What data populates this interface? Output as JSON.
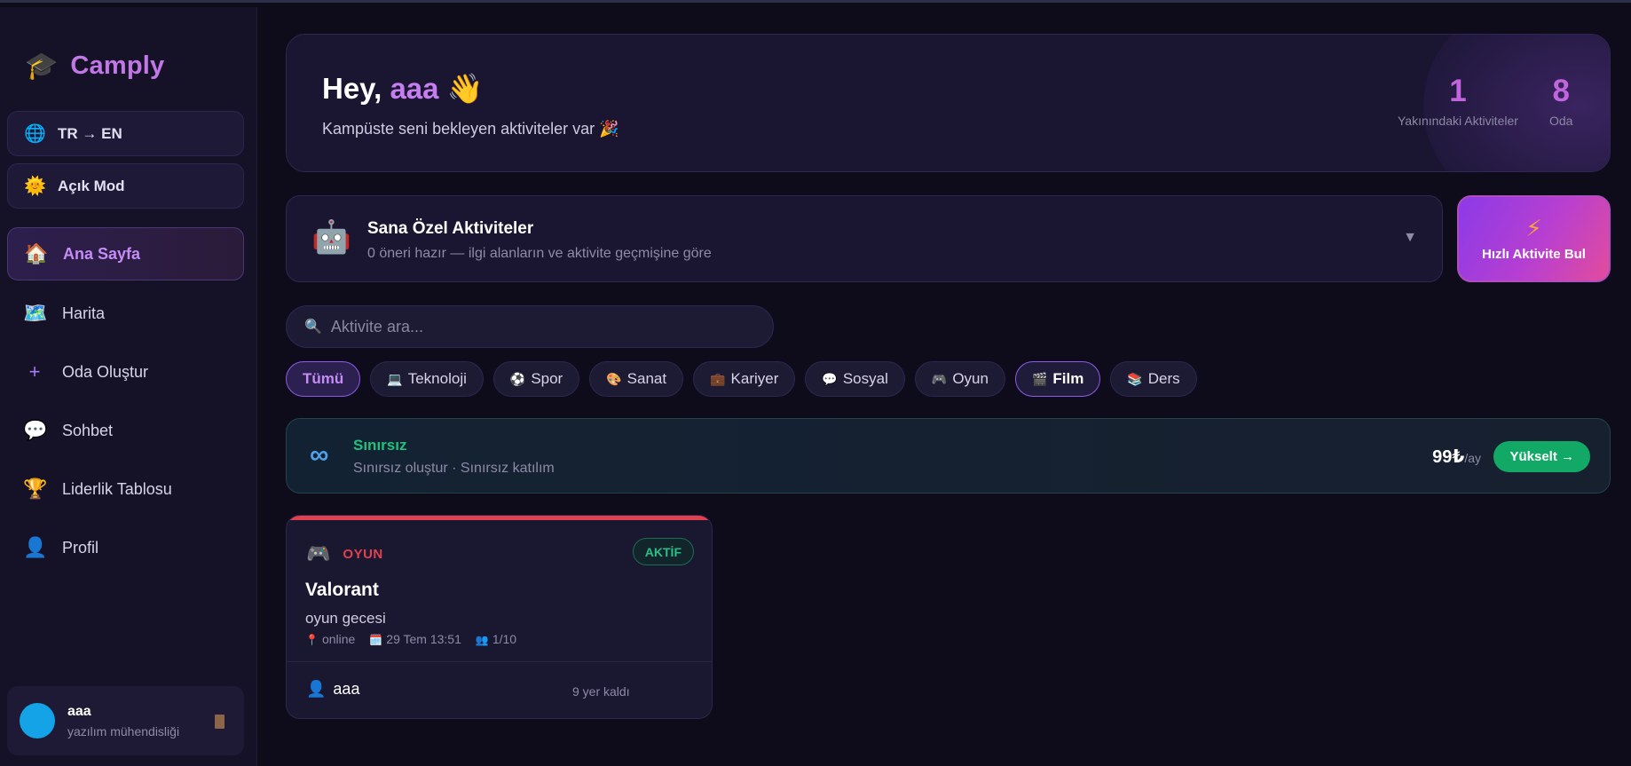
{
  "app": {
    "name": "Camply",
    "logo_icon": "🎓"
  },
  "sidebar": {
    "lang_toggle": {
      "icon": "🌐",
      "label": "TR → EN"
    },
    "theme_toggle": {
      "icon": "🌞",
      "label": "Açık Mod"
    },
    "items": [
      {
        "icon": "🏠",
        "label": "Ana Sayfa",
        "active": true
      },
      {
        "icon": "🗺️",
        "label": "Harita"
      },
      {
        "icon": "+",
        "label": "Oda Oluştur"
      },
      {
        "icon": "💬",
        "label": "Sohbet"
      },
      {
        "icon": "🏆",
        "label": "Liderlik Tablosu"
      },
      {
        "icon": "👤",
        "label": "Profil"
      }
    ],
    "user": {
      "name": "aaa",
      "department": "yazılım mühendisliği"
    }
  },
  "hero": {
    "greeting": "Hey,",
    "username": "aaa",
    "wave": "👋",
    "subtitle": "Kampüste seni bekleyen aktiviteler var 🎉",
    "stats": [
      {
        "value": "1",
        "label": "Yakınındaki Aktiviteler"
      },
      {
        "value": "8",
        "label": "Oda"
      }
    ]
  },
  "recommend": {
    "icon": "🤖",
    "title": "Sana Özel Aktiviteler",
    "subtitle": "0 öneri hazır — ilgi alanların ve aktivite geçmişine göre",
    "chevron": "▼"
  },
  "quick_find": {
    "icon": "⚡",
    "label": "Hızlı Aktivite Bul"
  },
  "search": {
    "icon": "🔍",
    "placeholder": "Aktivite ara..."
  },
  "filters": [
    {
      "icon": "",
      "label": "Tümü",
      "state": "active"
    },
    {
      "icon": "💻",
      "label": "Teknoloji"
    },
    {
      "icon": "⚽",
      "label": "Spor"
    },
    {
      "icon": "🎨",
      "label": "Sanat"
    },
    {
      "icon": "💼",
      "label": "Kariyer"
    },
    {
      "icon": "💬",
      "label": "Sosyal"
    },
    {
      "icon": "🎮",
      "label": "Oyun"
    },
    {
      "icon": "🎬",
      "label": "Film",
      "state": "active-alt"
    },
    {
      "icon": "📚",
      "label": "Ders"
    }
  ],
  "promo": {
    "icon": "∞",
    "title": "Sınırsız",
    "subtitle": "Sınırsız oluştur · Sınırsız katılım",
    "price": "99₺",
    "per": "/ay",
    "button": "Yükselt →"
  },
  "activity": {
    "category_icon": "🎮",
    "category": "OYUN",
    "status": "AKTİF",
    "title": "Valorant",
    "description": "oyun gecesi",
    "location_icon": "📍",
    "location": "online",
    "date_icon": "🗓️",
    "date": "29 Tem 13:51",
    "people_icon": "👥",
    "capacity": "1/10",
    "owner_icon": "👤",
    "owner": "aaa",
    "spots_left": "9 yer kaldı"
  },
  "colors": {
    "accent": "#c277e6",
    "background": "#0e0c1a",
    "sidebar": "#151228",
    "success": "#12a865",
    "danger": "#e0414f"
  }
}
